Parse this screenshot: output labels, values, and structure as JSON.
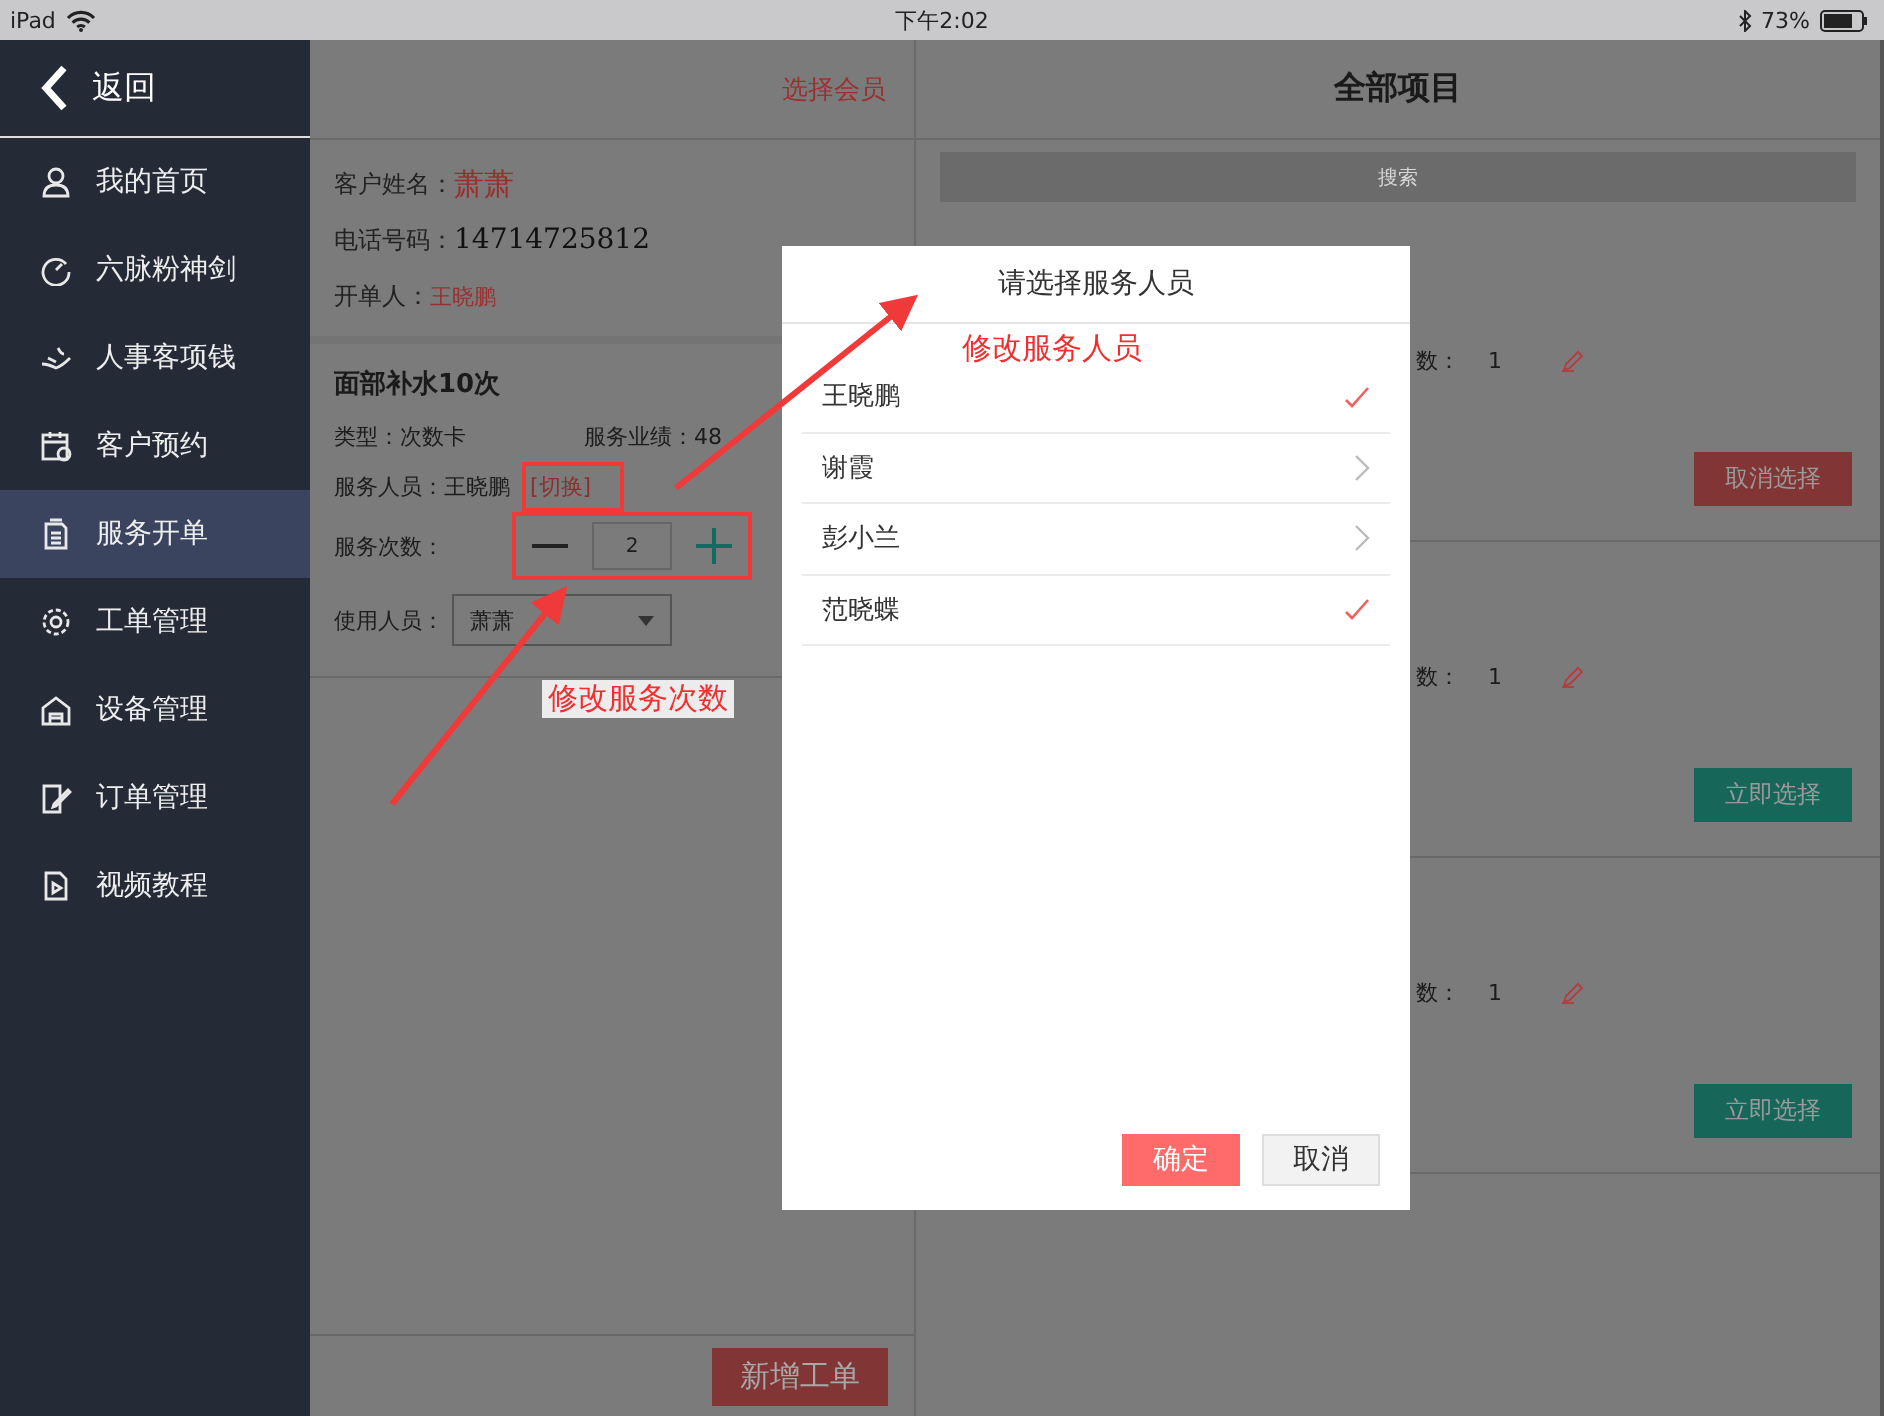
{
  "status_bar": {
    "device": "iPad",
    "time": "下午2:02",
    "battery": "73%"
  },
  "sidebar": {
    "back": "返回",
    "items": [
      {
        "label": "我的首页",
        "selected": false
      },
      {
        "label": "六脉粉神剑",
        "selected": false
      },
      {
        "label": "人事客项钱",
        "selected": false
      },
      {
        "label": "客户预约",
        "selected": false
      },
      {
        "label": "服务开单",
        "selected": true
      },
      {
        "label": "工单管理",
        "selected": false
      },
      {
        "label": "设备管理",
        "selected": false
      },
      {
        "label": "订单管理",
        "selected": false
      },
      {
        "label": "视频教程",
        "selected": false
      }
    ]
  },
  "order": {
    "select_member": "选择会员",
    "customer": [
      {
        "label": "客户姓名：",
        "value": "萧萧",
        "kind": "name"
      },
      {
        "label": "电话号码：",
        "value": "14714725812",
        "kind": "phone"
      },
      {
        "label": "开单人：",
        "value": "王晓鹏",
        "kind": "small"
      }
    ],
    "item": {
      "title": "面部补水10次",
      "type_label": "类型：",
      "type": "次数卡",
      "perf_label": "服务业绩：",
      "perf": "48",
      "staff_label": "服务人员：",
      "staff": "王晓鹏",
      "switch": "[切换]",
      "count_label": "服务次数：",
      "count": "2",
      "user_label": "使用人员：",
      "user": "萧萧"
    },
    "new_button": "新增工单"
  },
  "projects": {
    "title": "全部项目",
    "search_placeholder": "搜索",
    "cards": [
      {
        "count_label": "数：",
        "count": "1",
        "button": "取消选择",
        "selected": true
      },
      {
        "count_label": "数：",
        "count": "1",
        "button": "立即选择",
        "selected": false
      },
      {
        "count_label": "数：",
        "count": "1",
        "button": "立即选择",
        "selected": false
      }
    ]
  },
  "dialog": {
    "title": "请选择服务人员",
    "staff": [
      {
        "name": "王晓鹏",
        "selected": true
      },
      {
        "name": "谢霞",
        "selected": false
      },
      {
        "name": "彭小兰",
        "selected": false
      },
      {
        "name": "范晓蝶",
        "selected": true
      }
    ],
    "confirm": "确定",
    "cancel": "取消"
  },
  "annotations": [
    "修改服务人员",
    "修改服务次数"
  ]
}
